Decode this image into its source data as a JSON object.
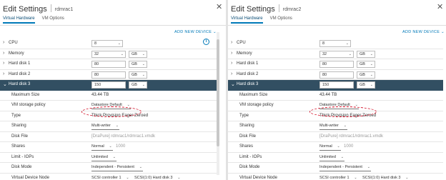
{
  "panels": [
    {
      "title": "Edit Settings",
      "vm_name": "rdmrac1",
      "tabs": [
        "Virtual Hardware",
        "VM Options"
      ],
      "add_device": "ADD NEW DEVICE",
      "cpu": {
        "label": "CPU",
        "value": "8"
      },
      "memory": {
        "label": "Memory",
        "value": "32",
        "unit": "GB"
      },
      "disk1": {
        "label": "Hard disk 1",
        "value": "80",
        "unit": "GB"
      },
      "disk2": {
        "label": "Hard disk 2",
        "value": "80",
        "unit": "GB"
      },
      "disk3": {
        "label": "Hard disk 3",
        "value": "150",
        "unit": "GB"
      },
      "max_size": {
        "label": "Maximum Size",
        "value": "43.44 TB"
      },
      "storage_policy": {
        "label": "VM storage policy",
        "value": "Datastore Default"
      },
      "type": {
        "label": "Type",
        "value": "Thick Provision Eager Zeroed"
      },
      "sharing": {
        "label": "Sharing",
        "value": "Multi-writer"
      },
      "disk_file": {
        "label": "Disk File",
        "value": "[DraPure] rdmrac1/rdmrac1.vmdk"
      },
      "shares": {
        "label": "Shares",
        "value": "Normal",
        "num": "1000"
      },
      "limit": {
        "label": "Limit - IOPs",
        "value": "Unlimited"
      },
      "disk_mode": {
        "label": "Disk Mode",
        "value": "Independent - Persistent"
      },
      "vdn": {
        "label": "Virtual Device Node",
        "controller": "SCSI controller 1",
        "slot": "SCSI(1:0) Hard disk 3"
      }
    },
    {
      "title": "Edit Settings",
      "vm_name": "rdmrac2",
      "tabs": [
        "Virtual Hardware",
        "VM Options"
      ],
      "add_device": "ADD NEW DEVICE",
      "cpu": {
        "label": "CPU",
        "value": "8"
      },
      "memory": {
        "label": "Memory",
        "value": "32",
        "unit": "GB"
      },
      "disk1": {
        "label": "Hard disk 1",
        "value": "80",
        "unit": "GB"
      },
      "disk2": {
        "label": "Hard disk 2",
        "value": "80",
        "unit": "GB"
      },
      "disk3": {
        "label": "Hard disk 3",
        "value": "150",
        "unit": "GB"
      },
      "max_size": {
        "label": "Maximum Size",
        "value": "43.44 TB"
      },
      "storage_policy": {
        "label": "VM storage policy",
        "value": "Datastore Default"
      },
      "type": {
        "label": "Type",
        "value": "Thick Provision Eager Zeroed"
      },
      "sharing": {
        "label": "Sharing",
        "value": "Multi-writer"
      },
      "disk_file": {
        "label": "Disk File",
        "value": "[DraPure] rdmrac1/rdmrac1.vmdk"
      },
      "shares": {
        "label": "Shares",
        "value": "Normal",
        "num": "1000"
      },
      "limit": {
        "label": "Limit - IOPs",
        "value": "Unlimited"
      },
      "disk_mode": {
        "label": "Disk Mode",
        "value": "Independent - Persistent"
      },
      "vdn": {
        "label": "Virtual Device Node",
        "controller": "SCSI controller 1",
        "slot": "SCSI(1:0) Hard disk 3"
      }
    }
  ],
  "icons": {
    "close": "close-icon",
    "info": "info-icon",
    "expand": "chevron-right-icon",
    "collapse": "chevron-down-icon"
  },
  "colors": {
    "accent": "#0079b8",
    "selected_row": "#324f62",
    "highlight_ring": "#d0021b"
  }
}
